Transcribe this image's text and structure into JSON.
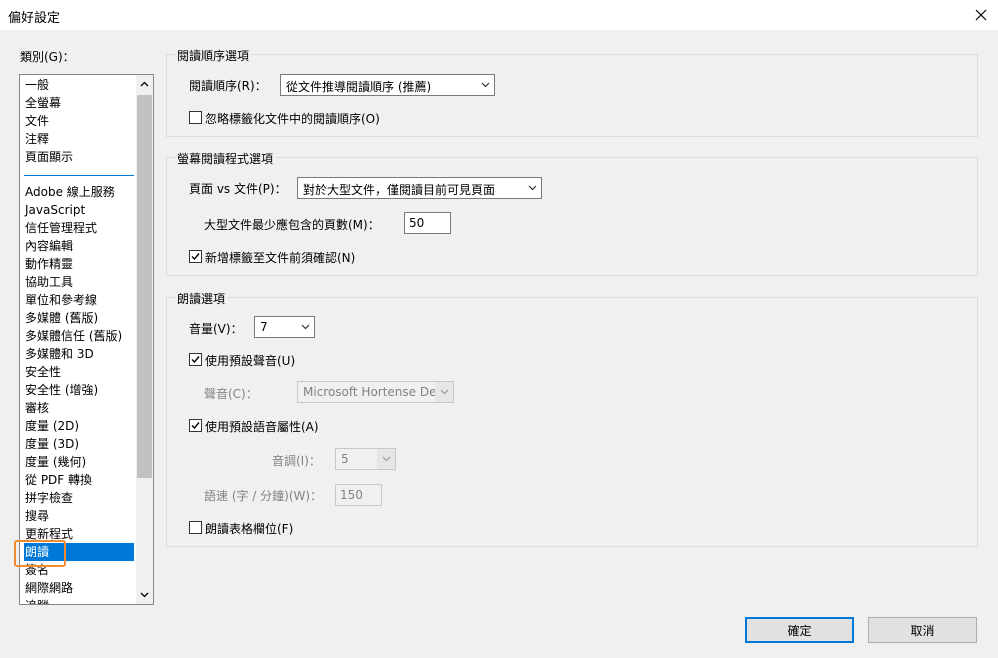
{
  "window": {
    "title": "偏好設定"
  },
  "categories": {
    "label": "類別(G)：",
    "top_items": [
      "一般",
      "全螢幕",
      "文件",
      "注釋",
      "頁面顯示"
    ],
    "items": [
      "Adobe 線上服務",
      "JavaScript",
      "信任管理程式",
      "內容編輯",
      "動作精靈",
      "協助工具",
      "單位和參考線",
      "多媒體 (舊版)",
      "多媒體信任 (舊版)",
      "多媒體和 3D",
      "安全性",
      "安全性 (增強)",
      "審核",
      "度量 (2D)",
      "度量 (3D)",
      "度量 (幾何)",
      "從 PDF 轉換",
      "拼字檢查",
      "搜尋",
      "更新程式",
      "朗讀",
      "簽名",
      "網際網路",
      "追蹤"
    ],
    "selected": "朗讀"
  },
  "reading_order": {
    "group_title": "閱讀順序選項",
    "order_label": "閱讀順序(R)：",
    "order_value": "從文件推導閱讀順序 (推薦)",
    "override_label": "忽略標籤化文件中的閱讀順序(O)",
    "override_checked": false
  },
  "screen_reader": {
    "group_title": "螢幕閱讀程式選項",
    "pages_label": "頁面 vs 文件(P)：",
    "pages_value": "對於大型文件，僅閱讀目前可見頁面",
    "min_pages_label": "大型文件最少應包含的頁數(M)：",
    "min_pages_value": "50",
    "confirm_label": "新增標籤至文件前須確認(N)",
    "confirm_checked": true
  },
  "read_out_loud": {
    "group_title": "朗讀選項",
    "volume_label": "音量(V)：",
    "volume_value": "7",
    "default_voice_label": "使用預設聲音(U)",
    "default_voice_checked": true,
    "voice_label": "聲音(C)：",
    "voice_value": "Microsoft Hortense Deskt",
    "default_speech_label": "使用預設語音屬性(A)",
    "default_speech_checked": true,
    "pitch_label": "音調(I)：",
    "pitch_value": "5",
    "rate_label": "語速 (字 / 分鐘)(W)：",
    "rate_value": "150",
    "table_label": "朗讀表格欄位(F)",
    "table_checked": false
  },
  "buttons": {
    "ok": "確定",
    "cancel": "取消"
  },
  "colors": {
    "selection": "#0078d7",
    "highlight_box": "#f08c2b"
  }
}
